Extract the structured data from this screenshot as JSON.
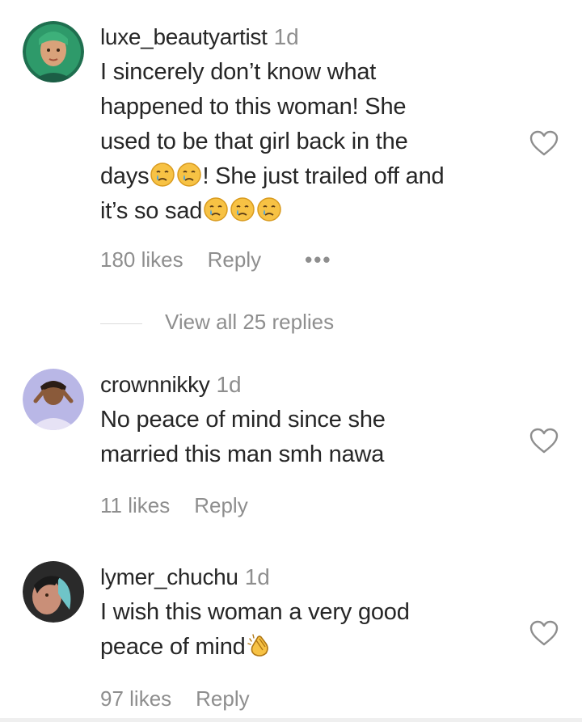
{
  "comments": [
    {
      "username": "luxe_beautyartist",
      "time": "1d",
      "lines": [
        "I sincerely don’t know what",
        "happened to this woman! She",
        "used to be that girl back in the"
      ],
      "line4_a": "days",
      "line4_b": "! She just trailed off and",
      "line5": "it’s so sad",
      "likes": "180 likes",
      "reply": "Reply",
      "more": "•••",
      "avatar_icon": "profile-photo",
      "emoji_icon": "crying-face-emoji"
    },
    {
      "username": "crownnikky",
      "time": "1d",
      "lines": [
        "No peace of mind since she",
        "married this man smh nawa"
      ],
      "likes": "11 likes",
      "reply": "Reply",
      "avatar_icon": "profile-photo"
    },
    {
      "username": "lymer_chuchu",
      "time": "1d",
      "lines": [
        "I wish this woman a very good"
      ],
      "line2": "peace of mind",
      "likes": "97 likes",
      "reply": "Reply",
      "avatar_icon": "profile-photo",
      "emoji_icon": "clapping-hands-emoji"
    }
  ],
  "view_replies": "View all 25 replies",
  "heart_icon": "heart-outline-icon",
  "colors": {
    "text": "#262626",
    "secondary": "#8e8e8e",
    "emoji_yellow": "#f7c244"
  }
}
